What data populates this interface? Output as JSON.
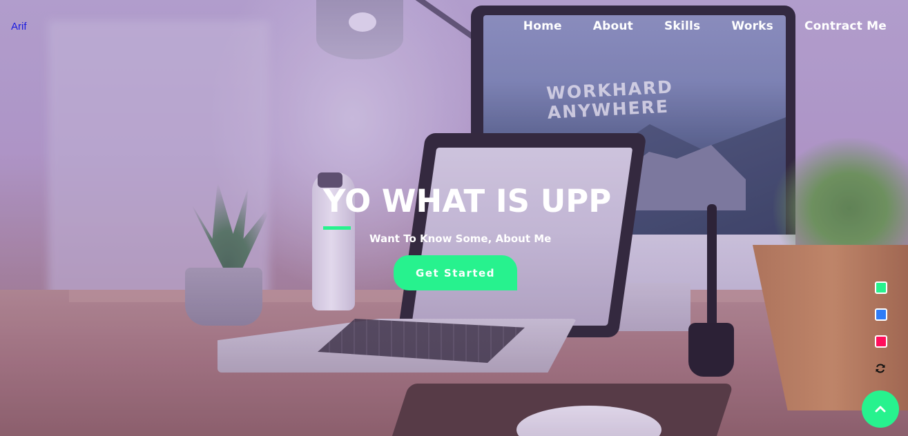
{
  "header": {
    "logo": "Arif",
    "nav": [
      {
        "label": "Home"
      },
      {
        "label": "About"
      },
      {
        "label": "Skills"
      },
      {
        "label": "Works"
      },
      {
        "label": "Contract Me"
      }
    ]
  },
  "hero": {
    "title": "YO WHAT IS UPP",
    "subtitle": "Want To Know Some, About Me",
    "cta_label": "Get Started",
    "background_image_text": "WORKHARD ANYWHERE"
  },
  "theme_switcher": {
    "swatches": [
      {
        "name": "green",
        "color": "#27f28e"
      },
      {
        "name": "blue",
        "color": "#2f7cf6"
      },
      {
        "name": "pink",
        "color": "#ff0f5c"
      }
    ],
    "reset_icon": "refresh-icon"
  },
  "scroll_top": {
    "icon": "chevron-up-icon"
  },
  "colors": {
    "accent": "#27f28e",
    "logo": "#1a1ae0",
    "text": "#ffffff"
  }
}
